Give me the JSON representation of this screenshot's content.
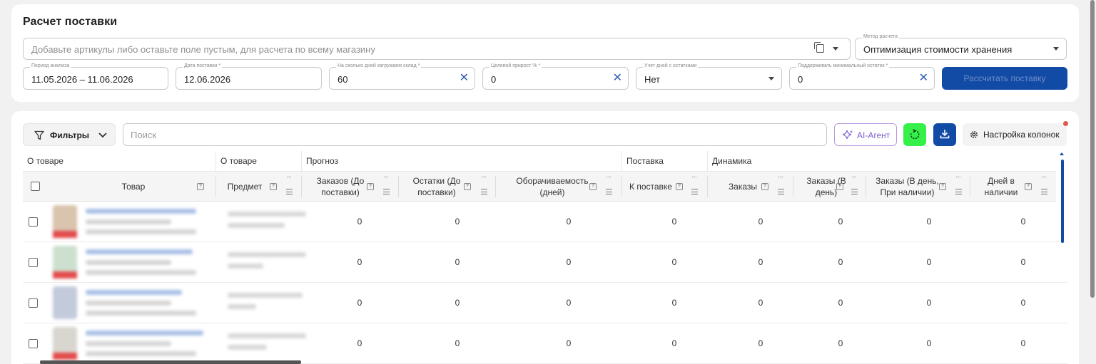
{
  "calc": {
    "title": "Расчет поставки",
    "articles_placeholder": "Добавьте артикулы либо оставьте поле пустым, для расчета по всему магазину",
    "method_label": "Метод расчета",
    "method_value": "Оптимизация стоимости хранения",
    "period_label": "Период анализа",
    "period_value": "11.05.2026 – 11.06.2026",
    "date_label": "Дата поставки *",
    "date_value": "12.06.2026",
    "days_label": "На сколько дней загружаем склад *",
    "days_value": "60",
    "growth_label": "Целевой прирост % *",
    "growth_value": "0",
    "stock_days_label": "Учет дней с остатками",
    "stock_days_value": "Нет",
    "min_stock_label": "Поддерживать минимальный остаток *",
    "min_stock_value": "0",
    "calc_button": "Рассчитать поставку"
  },
  "toolbar": {
    "filters_label": "Фильтры",
    "search_placeholder": "Поиск",
    "ai_label": "AI-Агент",
    "columns_label": "Настройка колонок"
  },
  "table": {
    "groups": [
      "О товаре",
      "О товаре",
      "Прогноз",
      "Поставка",
      "Динамика"
    ],
    "headers": {
      "product": "Товар",
      "subject": "Предмет",
      "orders": "Заказов (До поставки)",
      "stock": "Остатки (До поставки)",
      "turnover": "Оборачиваемость (дней)",
      "to_supply": "К поставке",
      "orders_dyn": "Заказы",
      "orders_day": "Заказы (В день)",
      "orders_day_avail": "Заказы (В день, При наличии)",
      "days_avail": "Дней в наличии"
    },
    "rows": [
      {
        "orders": "0",
        "stock": "0",
        "turnover": "0",
        "to_supply": "0",
        "orders_dyn": "0",
        "orders_day": "0",
        "orders_day_avail": "0",
        "days_avail": "0"
      },
      {
        "orders": "0",
        "stock": "0",
        "turnover": "0",
        "to_supply": "0",
        "orders_dyn": "0",
        "orders_day": "0",
        "orders_day_avail": "0",
        "days_avail": "0"
      },
      {
        "orders": "0",
        "stock": "0",
        "turnover": "0",
        "to_supply": "0",
        "orders_dyn": "0",
        "orders_day": "0",
        "orders_day_avail": "0",
        "days_avail": "0"
      },
      {
        "orders": "0",
        "stock": "0",
        "turnover": "0",
        "to_supply": "0",
        "orders_dyn": "0",
        "orders_day": "0",
        "orders_day_avail": "0",
        "days_avail": "0"
      }
    ]
  },
  "colors": {
    "primary": "#124ba6",
    "accent_green": "#36f04a",
    "ai_purple": "#7e5fd0"
  }
}
